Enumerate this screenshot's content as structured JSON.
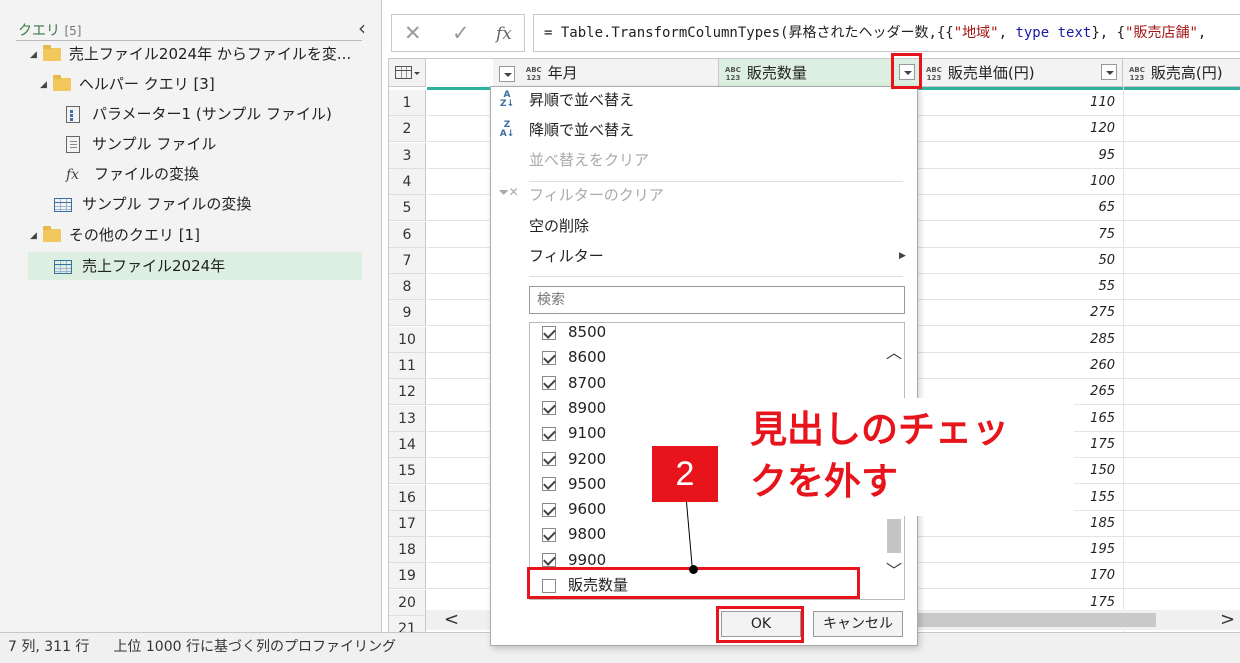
{
  "query_pane": {
    "title": "クエリ",
    "count": "[5]",
    "items": [
      {
        "label": "売上ファイル2024年 からファイルを変..."
      },
      {
        "label": "ヘルパー クエリ [3]"
      },
      {
        "label": "パラメーター1 (サンプル ファイル)"
      },
      {
        "label": "サンプル ファイル"
      },
      {
        "label": "ファイルの変換"
      },
      {
        "label": "サンプル ファイルの変換"
      },
      {
        "label": "その他のクエリ [1]"
      },
      {
        "label": "売上ファイル2024年"
      }
    ]
  },
  "formula_bar": {
    "cancel_glyph": "✕",
    "confirm_glyph": "✓",
    "fx_glyph": "fx",
    "eq": "= ",
    "fn": "Table.TransformColumnTypes",
    "part1": "(昇格されたヘッダー数,{{",
    "str1": "\"地域\"",
    "sep1": ", ",
    "kw": "type",
    "sep2": " ",
    "kw2": "text",
    "part2": "}, {",
    "str2": "\"販売店舗\"",
    "part3": ","
  },
  "grid": {
    "abc_top": "ABC",
    "abc_bottom": "123",
    "columns": [
      "年月",
      "販売数量",
      "販売単価(円)",
      "販売高(円)"
    ],
    "row_numbers": [
      "1",
      "2",
      "3",
      "4",
      "5",
      "6",
      "7",
      "8",
      "9",
      "10",
      "11",
      "12",
      "13",
      "14",
      "15",
      "16",
      "17",
      "18",
      "19",
      "20",
      "21"
    ],
    "unit_prices": [
      "110",
      "120",
      "95",
      "100",
      "65",
      "75",
      "50",
      "55",
      "275",
      "285",
      "260",
      "265",
      "165",
      "175",
      "150",
      "155",
      "185",
      "195",
      "170",
      "175"
    ]
  },
  "status_bar": {
    "dims": "7 列, 311 行",
    "profiling": "上位 1000 行に基づく列のプロファイリング"
  },
  "filter_menu": {
    "sort_asc": "昇順で並べ替え",
    "sort_desc": "降順で並べ替え",
    "clear_sort": "並べ替えをクリア",
    "clear_filter": "フィルターのクリア",
    "remove_empty": "空の削除",
    "filters": "フィルター",
    "search_placeholder": "検索",
    "values": [
      {
        "label": "8500",
        "checked": true
      },
      {
        "label": "8600",
        "checked": true
      },
      {
        "label": "8700",
        "checked": true
      },
      {
        "label": "8900",
        "checked": true
      },
      {
        "label": "9100",
        "checked": true
      },
      {
        "label": "9200",
        "checked": true
      },
      {
        "label": "9500",
        "checked": true
      },
      {
        "label": "9600",
        "checked": true
      },
      {
        "label": "9800",
        "checked": true
      },
      {
        "label": "9900",
        "checked": true
      },
      {
        "label": "販売数量",
        "checked": false
      }
    ],
    "ok_label": "OK",
    "cancel_label": "キャンセル"
  },
  "annotation": {
    "step_number": "2",
    "line1": "見出しのチェッ",
    "line2": "クを外す",
    "accent_color": "#e8141b"
  },
  "colors": {
    "selection_green": "#dcefe0",
    "teal_bar": "#2fb0a0",
    "accent_red": "#e8141b"
  }
}
